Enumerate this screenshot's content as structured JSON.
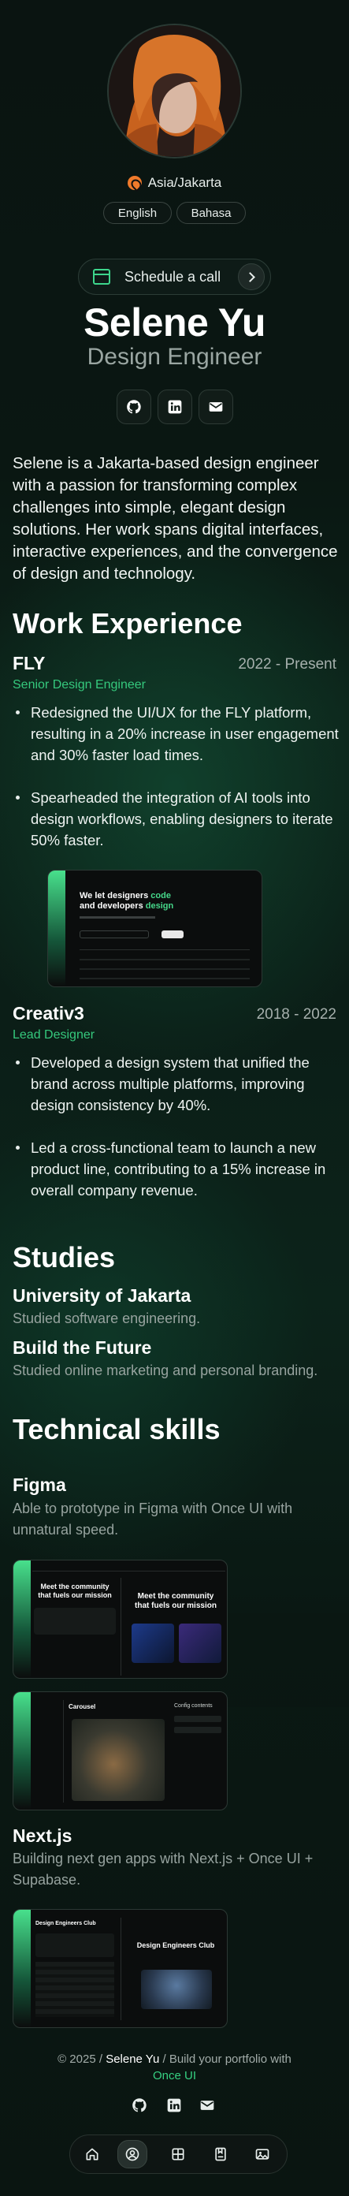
{
  "header": {
    "location": "Asia/Jakarta",
    "languages": [
      "English",
      "Bahasa"
    ],
    "schedule_label": "Schedule a call",
    "name": "Selene Yu",
    "role": "Design Engineer",
    "social_icons": [
      "github-icon",
      "linkedin-icon",
      "mail-icon"
    ]
  },
  "about": {
    "bio": "Selene is a Jakarta-based design engineer with a passion for transforming complex challenges into simple, elegant design solutions. Her work spans digital interfaces, interactive experiences, and the convergence of design and technology."
  },
  "work": {
    "title": "Work Experience",
    "jobs": [
      {
        "company": "FLY",
        "dates": "2022 - Present",
        "role": "Senior Design Engineer",
        "achievements": [
          "Redesigned the UI/UX for the FLY platform, resulting in a 20% increase in user engagement and 30% faster load times.",
          "Spearheaded the integration of AI tools into design workflows, enabling designers to iterate 50% faster."
        ],
        "screenshot": {
          "headline_1": "We let designers",
          "headline_1_accent": "code",
          "headline_2": "and developers",
          "headline_2_accent": "design"
        }
      },
      {
        "company": "Creativ3",
        "dates": "2018 - 2022",
        "role": "Lead Designer",
        "achievements": [
          "Developed a design system that unified the brand across multiple platforms, improving design consistency by 40%.",
          "Led a cross-functional team to launch a new product line, contributing to a 15% increase in overall company revenue."
        ]
      }
    ]
  },
  "studies": {
    "title": "Studies",
    "items": [
      {
        "name": "University of Jakarta",
        "description": "Studied software engineering."
      },
      {
        "name": "Build the Future",
        "description": "Studied online marketing and personal branding."
      }
    ]
  },
  "skills": {
    "title": "Technical skills",
    "items": [
      {
        "name": "Figma",
        "description": "Able to prototype in Figma with Once UI with unnatural speed.",
        "screenshot_1": {
          "headline": "Meet the community that fuels our mission",
          "headline_right": "Meet the community that fuels our mission"
        },
        "screenshot_2": {
          "title": "Carousel",
          "panel": "Config contents"
        }
      },
      {
        "name": "Next.js",
        "description": "Building next gen apps with Next.js + Once UI + Supabase.",
        "screenshot_1": {
          "title_left": "Design Engineers Club",
          "title_right": "Design Engineers Club"
        }
      }
    ]
  },
  "footer": {
    "copyright": "© 2025 /",
    "owner": "Selene Yu",
    "separator": "/ Build your portfolio with",
    "brand": "Once UI",
    "icons": [
      "github-icon",
      "linkedin-icon",
      "mail-icon"
    ]
  },
  "dock": {
    "items": [
      "home-icon",
      "about-icon",
      "work-icon",
      "blog-icon",
      "gallery-icon"
    ],
    "active": "about-icon"
  },
  "colors": {
    "accent": "#36d182",
    "background": "#06100c",
    "text": "#e8eeec",
    "muted": "#97a39f",
    "location_badge": "#f07a2b"
  }
}
